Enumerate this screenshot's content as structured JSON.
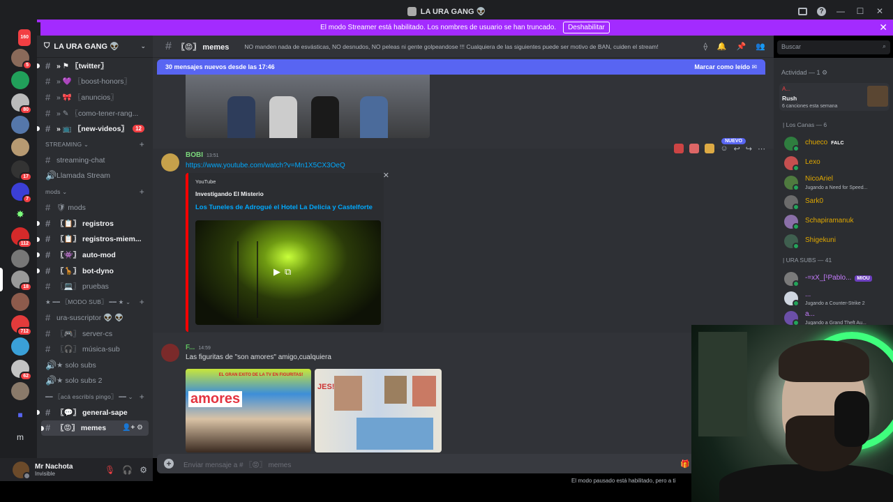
{
  "window": {
    "title": "LA URA GANG 👽"
  },
  "banner": {
    "text": "El modo Streamer está habilitado. Los nombres de usuario se han truncado.",
    "button": "Deshabilitar"
  },
  "rail": {
    "badges": [
      "160",
      "5",
      "80",
      "17",
      "7",
      "112",
      "18",
      "712",
      "62"
    ],
    "dm_icon": "discord-logo-icon",
    "m_label": "m"
  },
  "guild": {
    "name": "LA URA GANG 👽"
  },
  "channels": [
    {
      "type": "channel",
      "label": "» ⚑ 〖twitter〗",
      "unread": true
    },
    {
      "type": "channel",
      "label": "» 💜 〖boost-honors〗",
      "unread": false
    },
    {
      "type": "channel",
      "label": "» 🎀 〖anuncios〗",
      "unread": false
    },
    {
      "type": "channel",
      "label": "» ✎ 〖como-tener-rang...",
      "unread": false
    },
    {
      "type": "channel",
      "label": "» 📺 〖new-videos〗",
      "unread": true,
      "count": "12"
    },
    {
      "type": "category",
      "label": "STREAMING ⌄"
    },
    {
      "type": "channel",
      "label": "streaming-chat",
      "unread": false
    },
    {
      "type": "voice",
      "label": "Llamada Stream",
      "unread": false
    },
    {
      "type": "category",
      "label": "mods ⌄"
    },
    {
      "type": "channel",
      "label": "🛡 mods",
      "unread": false
    },
    {
      "type": "channel",
      "label": "〖📋〗 registros",
      "unread": true
    },
    {
      "type": "channel",
      "label": "〖📋〗 registros-miem...",
      "unread": true
    },
    {
      "type": "channel",
      "label": "〖👾〗 auto-mod",
      "unread": true
    },
    {
      "type": "channel",
      "label": "〖🦒〗 bot-dyno",
      "unread": true
    },
    {
      "type": "channel",
      "label": "〖💻〗 pruebas",
      "unread": false
    },
    {
      "type": "category",
      "label": "★ ━━ 〖MODO SUB〗 ━━ ★ ⌄"
    },
    {
      "type": "channel",
      "label": "ura-suscriptor 👽 👽",
      "unread": false
    },
    {
      "type": "channel",
      "label": "〖🎮〗 server-cs",
      "unread": false
    },
    {
      "type": "channel",
      "label": "〖🎧〗 música-sub",
      "unread": false
    },
    {
      "type": "voice",
      "label": "★ solo subs",
      "unread": false
    },
    {
      "type": "voice",
      "label": "★ solo subs 2",
      "unread": false
    },
    {
      "type": "category",
      "label": "━━ 〖acá escribís pingo〗 ━━ ⌄"
    },
    {
      "type": "channel",
      "label": "〖💬〗 general-sape",
      "unread": true
    },
    {
      "type": "channel",
      "label": "〖😡〗 memes",
      "unread": true,
      "selected": true
    }
  ],
  "user": {
    "name": "Mr Nachota",
    "status": "Invisible"
  },
  "chat_header": {
    "channel": "〖😡〗 memes",
    "topic": "NO manden nada de esvásticas, NO desnudos, NO peleas ni gente golpeandose !!! Cualquiera de las siguientes puede ser motivo de BAN, cuiden el stream!"
  },
  "new_messages": {
    "text": "30 mensajes nuevos desde las 17:46",
    "mark": "Marcar como leído"
  },
  "messages": [
    {
      "author": "BOBI",
      "time": "13:51",
      "link": "https://www.youtube.com/watch?v=Mn1X5CX3OeQ",
      "embed": {
        "provider": "YouTube",
        "author": "Investigando El Misterio",
        "title": "Los Tuneles de Adrogué el Hotel La Delicia y Castelforte"
      },
      "badge": "NUEVO"
    },
    {
      "author": "F...",
      "time": "14:59",
      "text": "Las figuritas de \"son amores\" amigo,cualquiera",
      "image1_text": "EL GRAN EXITO DE LA TV EN FIGURITAS!",
      "image1_title": "amores",
      "image2_text": "JES!"
    }
  ],
  "input": {
    "placeholder": "Enviar mensaje a # 〖😡〗 memes"
  },
  "paused_notice": "El modo pausado está habilitado, pero a ti",
  "search": {
    "placeholder": "Buscar"
  },
  "members": {
    "activity_header": "Actividad — 1",
    "activity": {
      "user": "A...",
      "game": "Rush",
      "detail": "6 canciones esta semana"
    },
    "roles": [
      {
        "name": "| Los Canas — 6",
        "members": [
          {
            "name": "chueco",
            "color": "#e0a800",
            "tag": "FALC"
          },
          {
            "name": "Lexo",
            "color": "#e0a800"
          },
          {
            "name": "NicoAriel",
            "color": "#e0a800",
            "status": "Jugando a Need for Speed..."
          },
          {
            "name": "Sark0",
            "color": "#e0a800"
          },
          {
            "name": "Schapiramanuk",
            "color": "#e0a800"
          },
          {
            "name": "Shigekuni",
            "color": "#e0a800"
          }
        ]
      },
      {
        "name": "| URA SUBS — 41",
        "members": [
          {
            "name": "-=xX_[¹Pablo...",
            "color": "#c77dff",
            "tag": "MIOU"
          },
          {
            "name": "...",
            "color": "#c77dff",
            "status": "Jugando a Counter-Strike 2"
          },
          {
            "name": "a...",
            "color": "#c77dff",
            "status": "Jugando a Grand Theft Au..."
          }
        ]
      }
    ]
  }
}
